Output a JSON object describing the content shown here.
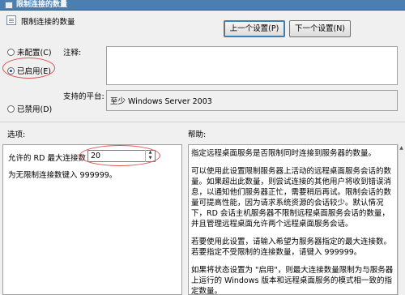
{
  "window": {
    "title": "限制连接的数量"
  },
  "header": {
    "title": "限制连接的数量",
    "prev_label": "上一个设置(P)",
    "next_label": "下一个设置(N)"
  },
  "state": {
    "options": [
      {
        "label": "未配置(C)",
        "checked": false
      },
      {
        "label": "已启用(E)",
        "checked": true
      },
      {
        "label": "已禁用(D)",
        "checked": false
      }
    ]
  },
  "comment": {
    "label": "注释:",
    "value": ""
  },
  "platform": {
    "label": "支持的平台:",
    "value": "至少 Windows Server 2003"
  },
  "sections": {
    "options_label": "选项:",
    "help_label": "帮助:"
  },
  "options": {
    "max_connections_label": "允许的 RD 最大连接数",
    "max_connections_value": "20",
    "note": "为无限制连接数键入 999999。"
  },
  "help": {
    "paragraphs": [
      "指定远程桌面服务是否限制同时连接到服务器的数量。",
      "可以使用此设置限制服务器上活动的远程桌面服务会话的数量。如果超出此数量，则尝试连接的其他用户将收到错误消息，以通知他们服务器正忙，需要稍后再试。限制会话的数量可提高性能，因为请求系统资源的会话较少。默认情况下，RD 会话主机服务器不限制远程桌面服务会话的数量，并且管理远程桌面允许两个远程桌面服务会话。",
      "若要使用此设置，请输入希望为服务器指定的最大连接数。若要指定不受限制的连接数量，请键入 999999。",
      "如果将状态设置为 \"启用\"，则最大连接数量限制为与服务器上运行的 Windows 版本和远程桌面服务的模式相一致的指定数量。"
    ]
  }
}
